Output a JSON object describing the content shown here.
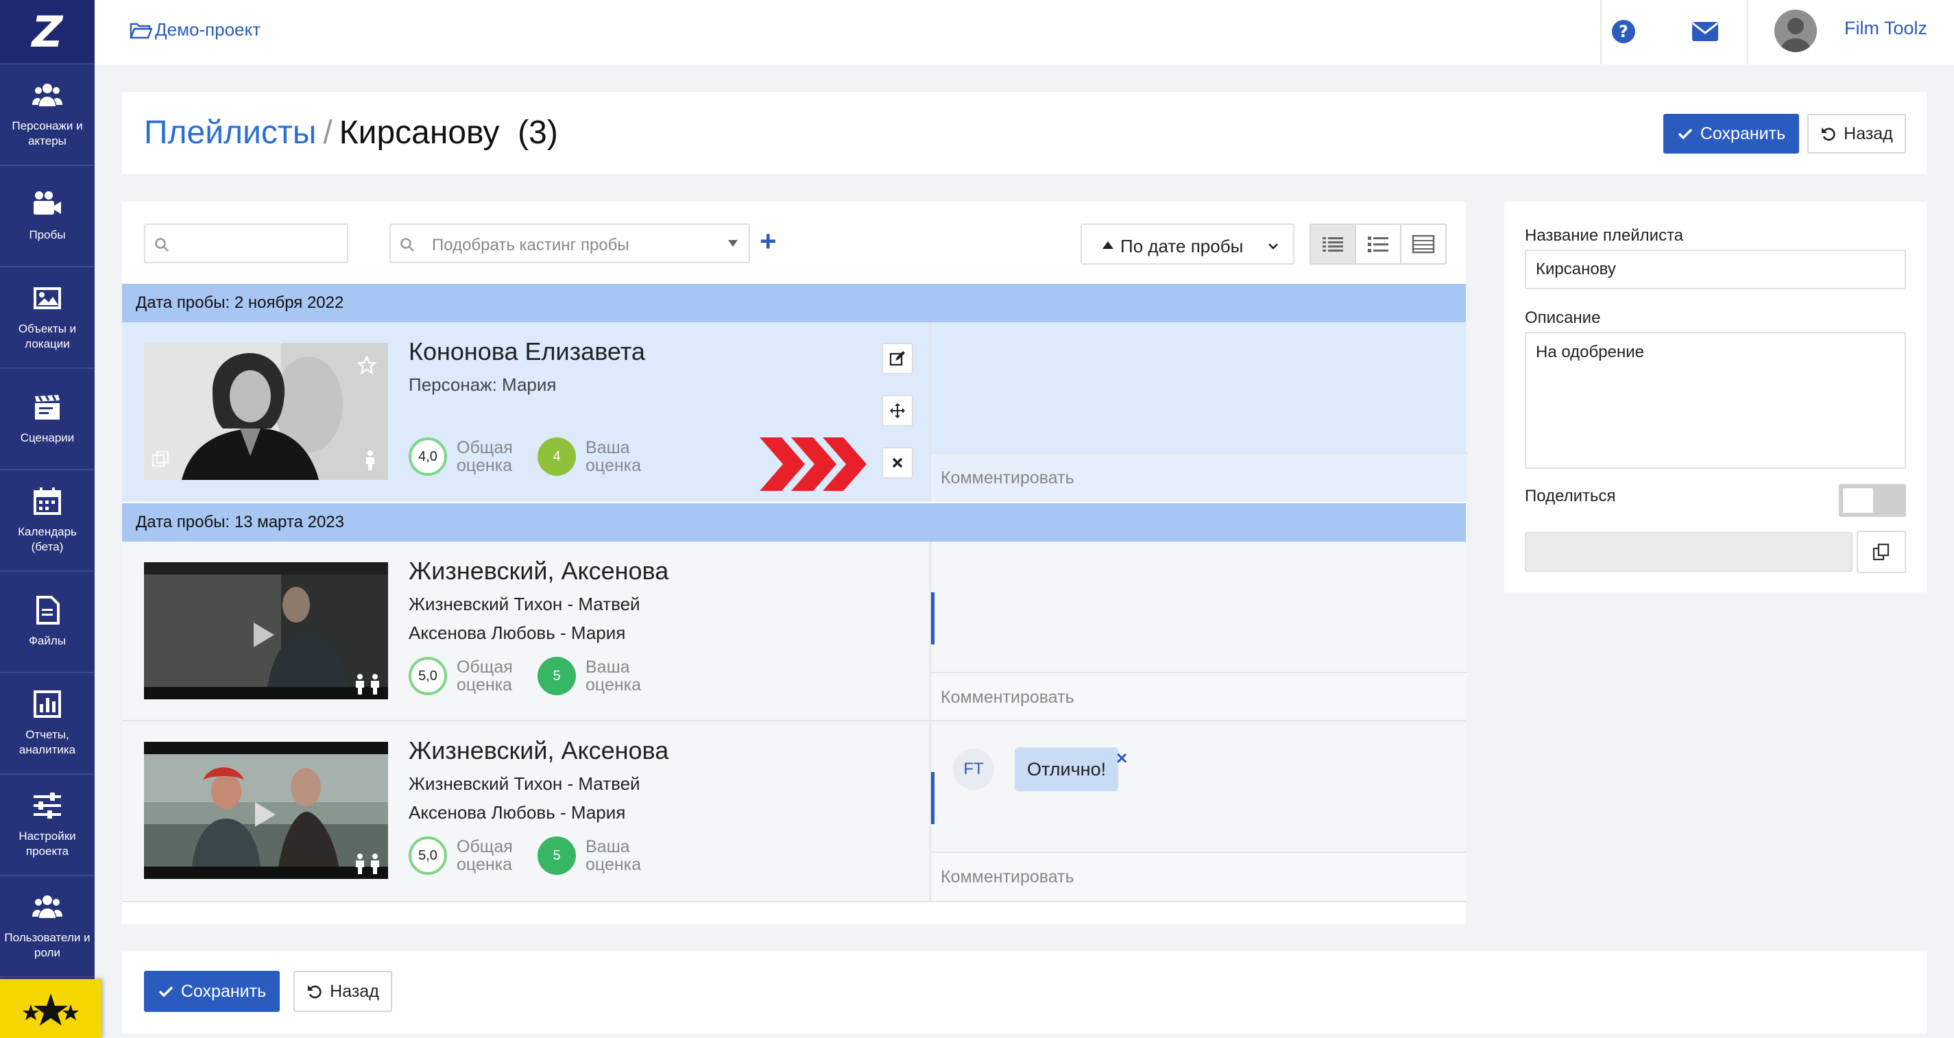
{
  "sidebar": {
    "logo": "Z",
    "items": [
      {
        "label": "Персонажи и актеры",
        "icon": "people-icon"
      },
      {
        "label": "Пробы",
        "icon": "video-camera-icon"
      },
      {
        "label": "Объекты и локации",
        "icon": "image-icon"
      },
      {
        "label": "Сценарии",
        "icon": "clapperboard-icon"
      },
      {
        "label": "Календарь (бета)",
        "icon": "calendar-icon"
      },
      {
        "label": "Файлы",
        "icon": "file-icon"
      },
      {
        "label": "Отчеты, аналитика",
        "icon": "bar-chart-icon"
      },
      {
        "label": "Настройки проекта",
        "icon": "sliders-icon"
      },
      {
        "label": "Пользователи и роли",
        "icon": "users-icon"
      }
    ]
  },
  "topbar": {
    "project": "Демо-проект",
    "user": "Film Toolz"
  },
  "header": {
    "crumb_link": "Плейлисты",
    "crumb_sep": "/",
    "title": "Кирсанову",
    "count": "(3)",
    "save_label": "Сохранить",
    "back_label": "Назад"
  },
  "toolbar": {
    "search_placeholder": "",
    "casting_placeholder": "Подобрать кастинг пробы",
    "sort_label": "По дате пробы"
  },
  "groups": [
    {
      "date_label": "Дата пробы: 2 ноября 2022"
    },
    {
      "date_label": "Дата пробы: 13 марта 2023"
    }
  ],
  "rows": [
    {
      "name": "Кононова Елизавета",
      "lines": [
        "Персонаж: Мария"
      ],
      "overall_score": "4,0",
      "your_score": "4",
      "comment_placeholder": "Комментировать"
    },
    {
      "name": "Жизневский, Аксенова",
      "lines": [
        "Жизневский Тихон - Матвей",
        "Аксенова Любовь - Мария"
      ],
      "overall_score": "5,0",
      "your_score": "5",
      "comment_placeholder": "Комментировать"
    },
    {
      "name": "Жизневский, Аксенова",
      "lines": [
        "Жизневский Тихон - Матвей",
        "Аксенова Любовь - Мария"
      ],
      "overall_score": "5,0",
      "your_score": "5",
      "comment_placeholder": "Комментировать",
      "comment": {
        "author_initials": "FT",
        "text": "Отлично!"
      }
    }
  ],
  "rating_labels": {
    "overall_1": "Общая",
    "overall_2": "оценка",
    "yours_1": "Ваша",
    "yours_2": "оценка"
  },
  "right_panel": {
    "name_label": "Название плейлиста",
    "name_value": "Кирсанову",
    "desc_label": "Описание",
    "desc_value": "На одобрение",
    "share_label": "Поделиться",
    "share_enabled": false
  },
  "footer": {
    "save_label": "Сохранить",
    "back_label": "Назад"
  },
  "colors": {
    "sidebar": "#26327a",
    "accent": "#2a5bbf",
    "date_bar": "#a7c6f2",
    "selected_row": "#dceafb",
    "arrows": "#e8202a"
  }
}
